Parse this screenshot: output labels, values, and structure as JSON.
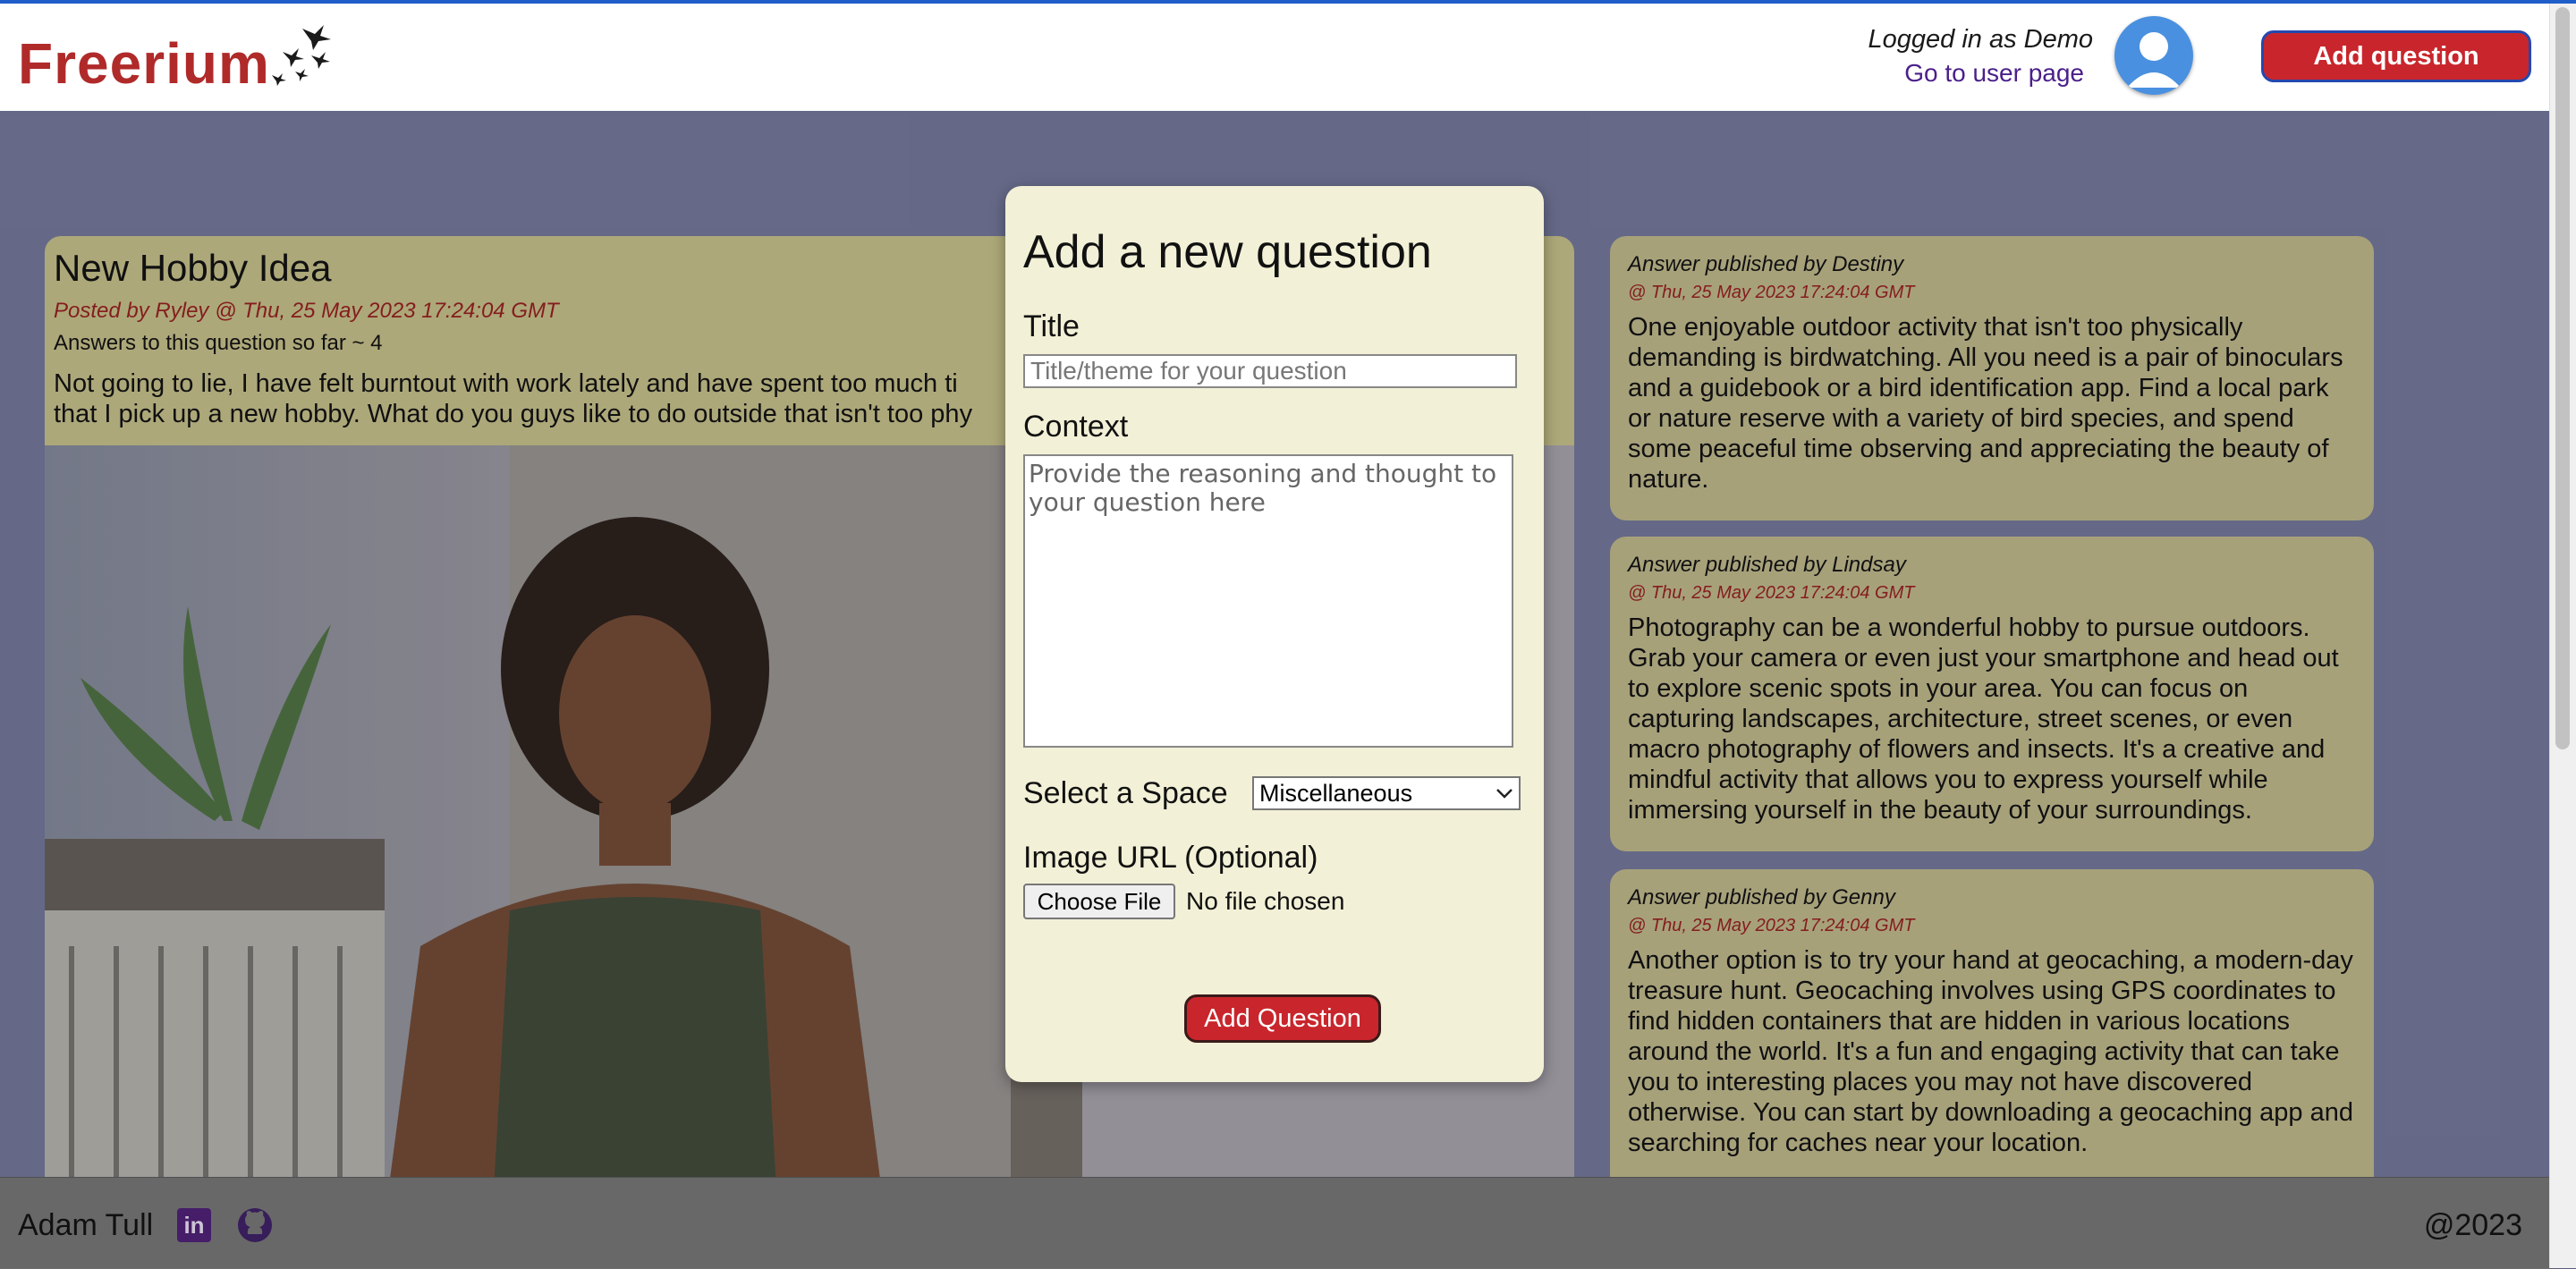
{
  "header": {
    "brand": "Freerium",
    "login_text": "Logged in as Demo",
    "user_link": "Go to user page",
    "add_question_label": "Add question"
  },
  "question": {
    "title": "New Hobby Idea",
    "meta": "Posted by Ryley @ Thu, 25 May 2023 17:24:04 GMT",
    "answers_count": "Answers to this question so far ~ 4",
    "body_line1": "Not going to lie, I have felt burntout with work lately and have spent too much ti",
    "body_line2": "that I pick up a new hobby. What do you guys like to do outside that isn't too phy"
  },
  "answers": [
    {
      "author": "Answer published by Destiny",
      "date": "@ Thu, 25 May 2023 17:24:04 GMT",
      "text": "One enjoyable outdoor activity that isn't too physically demanding is birdwatching. All you need is a pair of binoculars and a guidebook or a bird identification app. Find a local park or nature reserve with a variety of bird species, and spend some peaceful time observing and appreciating the beauty of nature."
    },
    {
      "author": "Answer published by Lindsay",
      "date": "@ Thu, 25 May 2023 17:24:04 GMT",
      "text": "Photography can be a wonderful hobby to pursue outdoors. Grab your camera or even just your smartphone and head out to explore scenic spots in your area. You can focus on capturing landscapes, architecture, street scenes, or even macro photography of flowers and insects. It's a creative and mindful activity that allows you to express yourself while immersing yourself in the beauty of your surroundings."
    },
    {
      "author": "Answer published by Genny",
      "date": "@ Thu, 25 May 2023 17:24:04 GMT",
      "text": "Another option is to try your hand at geocaching, a modern-day treasure hunt. Geocaching involves using GPS coordinates to find hidden containers that are hidden in various locations around the world. It's a fun and engaging activity that can take you to interesting places you may not have discovered otherwise. You can start by downloading a geocaching app and searching for caches near your location."
    }
  ],
  "modal": {
    "heading": "Add a new question",
    "title_label": "Title",
    "title_placeholder": "Title/theme for your question",
    "context_label": "Context",
    "context_placeholder": "Provide the reasoning and thought to your question here",
    "space_label": "Select a Space",
    "space_value": "Miscellaneous",
    "image_label": "Image URL (Optional)",
    "file_button": "Choose File",
    "file_status": "No file chosen",
    "submit_label": "Add Question"
  },
  "footer": {
    "name": "Adam Tull",
    "linkedin_glyph": "in",
    "copyright": "@2023"
  },
  "colors": {
    "brand": "#b02a2a",
    "accent_button": "#c8262c",
    "modal_bg": "#f2f0d6",
    "card_bg": "#b7b17f"
  }
}
